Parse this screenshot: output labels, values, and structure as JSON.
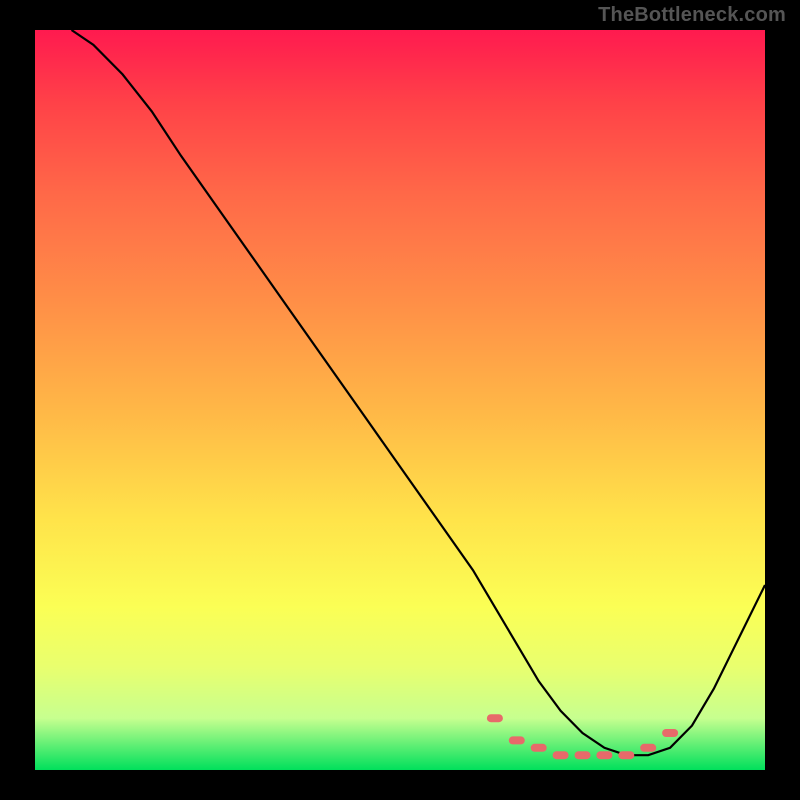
{
  "watermark": "TheBottleneck.com",
  "colors": {
    "curve_stroke": "#000000",
    "marker_fill": "#e76a6a",
    "background_black": "#000000",
    "gradient_top": "#ff1a4f",
    "gradient_bottom": "#00e05c"
  },
  "chart_data": {
    "type": "line",
    "title": "",
    "xlabel": "",
    "ylabel": "",
    "xlim": [
      0,
      100
    ],
    "ylim": [
      0,
      100
    ],
    "grid": false,
    "series": [
      {
        "name": "curve",
        "x": [
          5,
          8,
          12,
          16,
          20,
          25,
          30,
          35,
          40,
          45,
          50,
          55,
          60,
          63,
          66,
          69,
          72,
          75,
          78,
          81,
          84,
          87,
          90,
          93,
          96,
          100
        ],
        "y": [
          100,
          98,
          94,
          89,
          83,
          76,
          69,
          62,
          55,
          48,
          41,
          34,
          27,
          22,
          17,
          12,
          8,
          5,
          3,
          2,
          2,
          3,
          6,
          11,
          17,
          25
        ]
      }
    ],
    "markers": {
      "name": "highlighted-points",
      "x": [
        63,
        66,
        69,
        72,
        75,
        78,
        81,
        84,
        87
      ],
      "y": [
        7,
        4,
        3,
        2,
        2,
        2,
        2,
        3,
        5
      ]
    }
  }
}
